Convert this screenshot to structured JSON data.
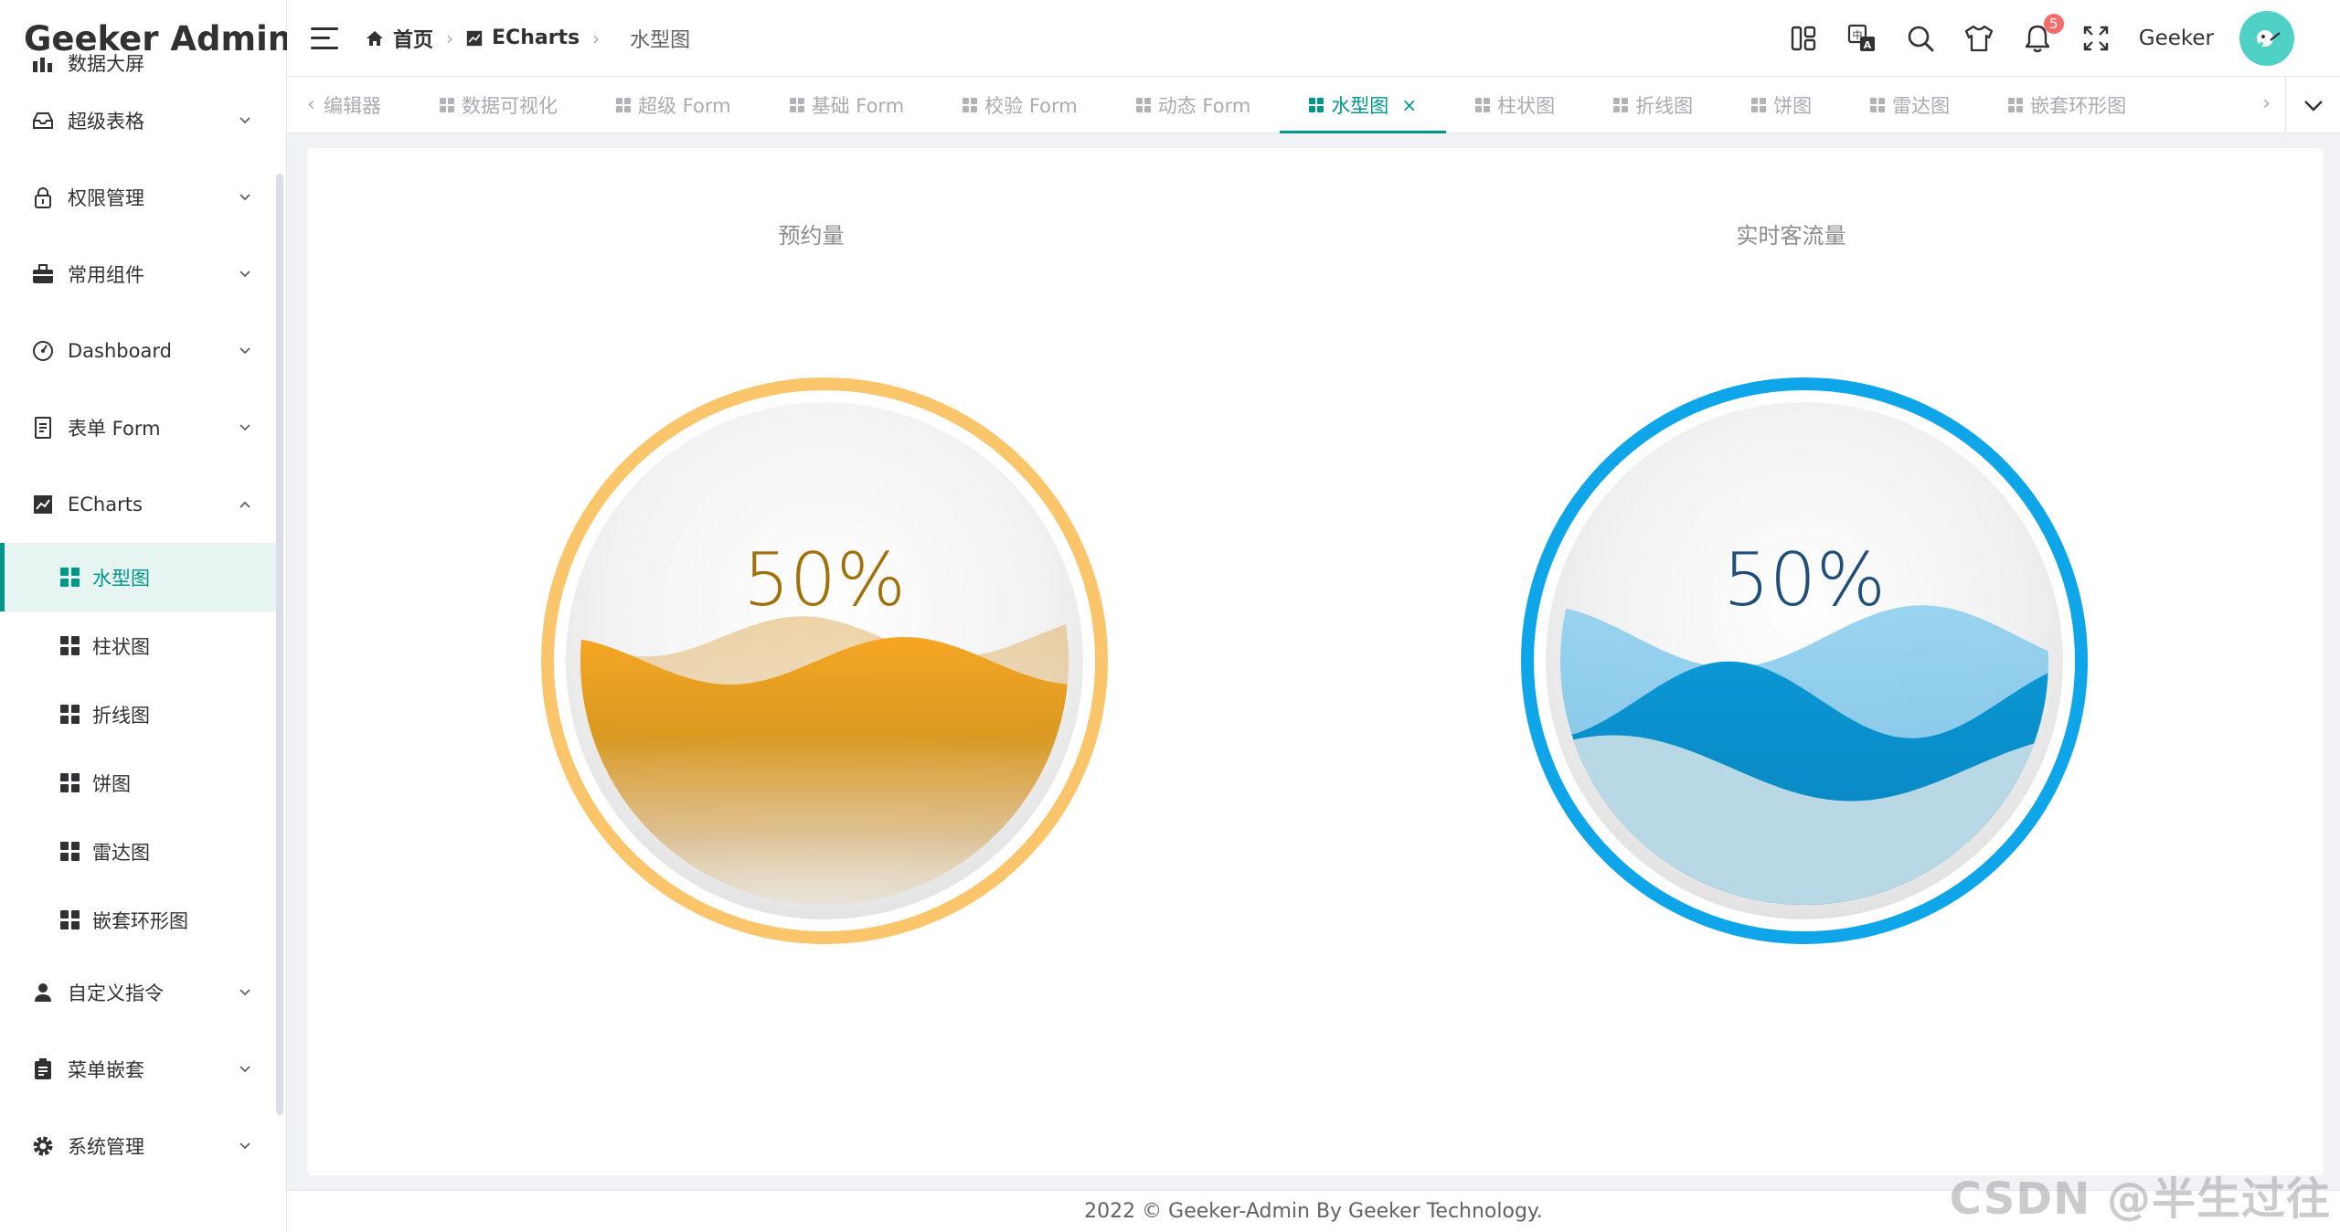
{
  "app": {
    "logo_text": "Geeker Admin",
    "brand_color": "#009688",
    "logo_green": "#41b883",
    "logo_dark": "#35495e"
  },
  "sidebar": {
    "cut_item": "数据大屏",
    "items": [
      {
        "label": "超级表格",
        "icon": "table-icon"
      },
      {
        "label": "权限管理",
        "icon": "lock-icon"
      },
      {
        "label": "常用组件",
        "icon": "briefcase-icon"
      },
      {
        "label": "Dashboard",
        "icon": "dashboard-gauge-icon"
      },
      {
        "label": "表单 Form",
        "icon": "document-icon"
      }
    ],
    "echarts": {
      "label": "ECharts",
      "icon": "chart-icon",
      "children": [
        {
          "label": "水型图",
          "active": true
        },
        {
          "label": "柱状图"
        },
        {
          "label": "折线图"
        },
        {
          "label": "饼图"
        },
        {
          "label": "雷达图"
        },
        {
          "label": "嵌套环形图"
        }
      ]
    },
    "items_after": [
      {
        "label": "自定义指令",
        "icon": "user-icon"
      },
      {
        "label": "菜单嵌套",
        "icon": "clipboard-icon"
      },
      {
        "label": "系统管理",
        "icon": "gear-icon"
      }
    ]
  },
  "header": {
    "breadcrumb": [
      {
        "label": "首页",
        "icon": "home-icon"
      },
      {
        "label": "ECharts",
        "icon": "chart-icon"
      },
      {
        "label": "水型图",
        "icon": "grid-icon"
      }
    ],
    "notification_count": "5",
    "username": "Geeker"
  },
  "tabs": [
    {
      "label": "编辑器"
    },
    {
      "label": "数据可视化"
    },
    {
      "label": "超级 Form"
    },
    {
      "label": "基础 Form"
    },
    {
      "label": "校验 Form"
    },
    {
      "label": "动态 Form"
    },
    {
      "label": "水型图",
      "active": true
    },
    {
      "label": "柱状图"
    },
    {
      "label": "折线图"
    },
    {
      "label": "饼图"
    },
    {
      "label": "雷达图"
    },
    {
      "label": "嵌套环形图"
    }
  ],
  "chart_data": [
    {
      "type": "liquidFill",
      "title": "预约量",
      "value": 0.5,
      "label": "50%",
      "border_color": "#fbc56c",
      "wave_color": "#f5a623",
      "label_color": "#a0700a"
    },
    {
      "type": "liquidFill",
      "title": "实时客流量",
      "value": 0.5,
      "label": "50%",
      "border_color": "#0ea5e9",
      "wave_color": "#0a97d4",
      "label_color": "#1e4e79"
    }
  ],
  "footer": {
    "text": "2022 © Geeker-Admin By Geeker Technology."
  },
  "watermark": "CSDN @半生过往"
}
